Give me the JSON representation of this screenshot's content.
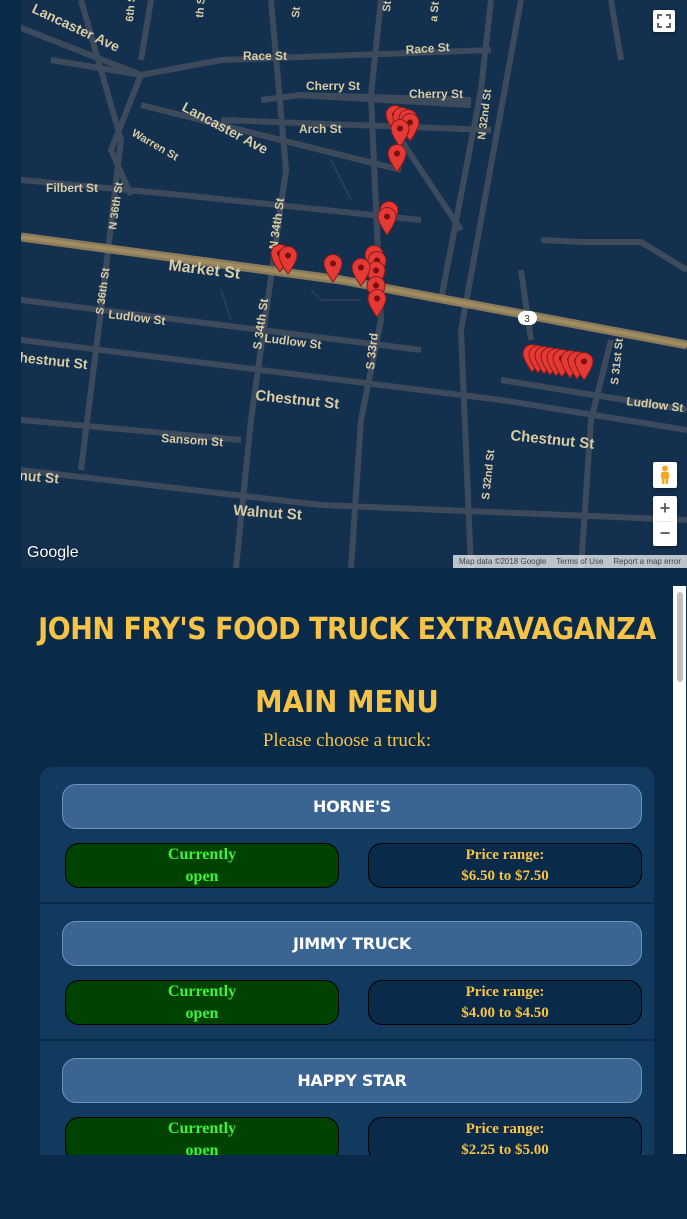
{
  "map": {
    "street_labels": {
      "lancaster_ave_top": "Lancaster Ave",
      "lancaster_ave_mid": "Lancaster Ave",
      "race_st_1": "Race St",
      "race_st_2": "Race St",
      "cherry_st_1": "Cherry St",
      "cherry_st_2": "Cherry St",
      "arch_st": "Arch St",
      "warren_st": "Warren St",
      "filbert_st": "Filbert St",
      "n_36th_st": "N 36th St",
      "n_34th_st": "N 34th St",
      "n_32nd_st": "N 32nd St",
      "market_st": "Market St",
      "s_36th_st": "S 36th St",
      "ludlow_st_1": "Ludlow St",
      "ludlow_st_2": "Ludlow St",
      "ludlow_st_3": "Ludlow St",
      "s_34th_st": "S 34th St",
      "s_33rd": "S 33rd",
      "s_31st_st": "S 31st St",
      "chestnut_st_left": "hestnut St",
      "chestnut_st_mid": "Chestnut St",
      "chestnut_st_right": "Chestnut St",
      "sansom_st": "Sansom St",
      "walnut_st_left": "nut St",
      "walnut_st_mid": "Walnut St",
      "s_32nd_st": "S 32nd St",
      "st_6th": "6th St",
      "st_th": "th St",
      "st_st": "St",
      "st_st2": "St",
      "st_a": "a St",
      "route_badge": "3"
    },
    "google_logo": "Google",
    "footer": {
      "map_data": "Map data ©2018 Google",
      "terms": "Terms of Use",
      "report": "Report a map error"
    },
    "zoom_in": "+",
    "zoom_out": "−"
  },
  "site_title": "JOHN FRY'S FOOD TRUCK EXTRAVAGANZA",
  "menu": {
    "heading": "MAIN MENU",
    "subheading": "Please choose a truck:",
    "trucks": [
      {
        "name": "HORNE'S",
        "status_line1": "Currently",
        "status_line2": "open",
        "price_line1": "Price range:",
        "price_line2": "$6.50 to $7.50"
      },
      {
        "name": "JIMMY TRUCK",
        "status_line1": "Currently",
        "status_line2": "open",
        "price_line1": "Price range:",
        "price_line2": "$4.00 to $4.50"
      },
      {
        "name": "HAPPY STAR",
        "status_line1": "Currently",
        "status_line2": "open",
        "price_line1": "Price range:",
        "price_line2": "$2.25 to $5.00"
      }
    ]
  },
  "colors": {
    "background": "#0a2a4a",
    "accent": "#f6c347",
    "open_green": "#3cf33c",
    "pin_red": "#e53935"
  }
}
